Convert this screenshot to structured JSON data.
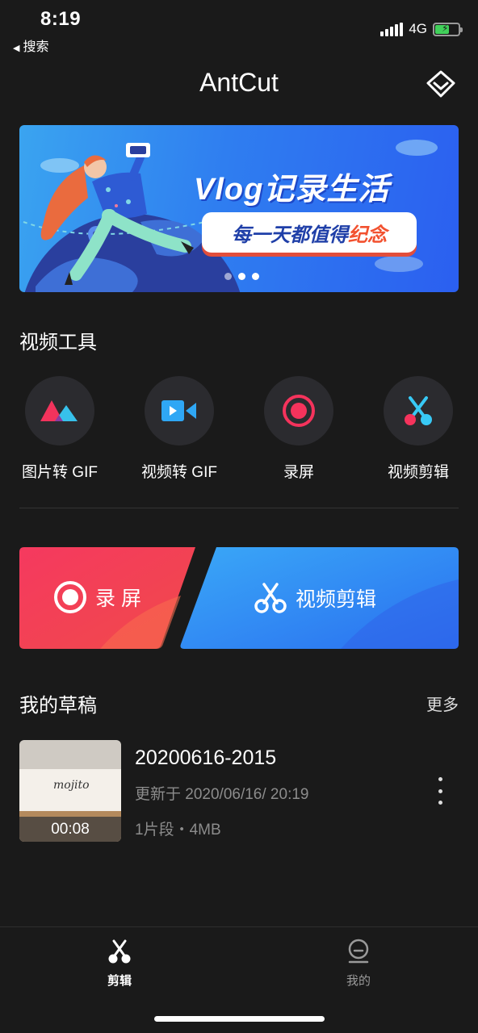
{
  "status_bar": {
    "time": "8:19",
    "back_label": "搜索",
    "network": "4G",
    "battery_color": "#41d05a"
  },
  "header": {
    "title": "AntCut",
    "vip_icon": "diamond-icon"
  },
  "banner": {
    "headline": "Vlog记录生活",
    "tagline_main": "每一天都值得",
    "tagline_accent": "纪念",
    "page_count": 3,
    "active_page": 2,
    "accent_colors": {
      "blue": "#2b5ff0",
      "red": "#f2512f"
    }
  },
  "tools_section": {
    "title": "视频工具",
    "items": [
      {
        "label": "图片转 GIF",
        "icon": "image-to-gif-icon"
      },
      {
        "label": "视频转 GIF",
        "icon": "video-to-gif-icon"
      },
      {
        "label": "录屏",
        "icon": "record-icon"
      },
      {
        "label": "视频剪辑",
        "icon": "scissors-icon"
      }
    ]
  },
  "quick_actions": {
    "record_label": "录 屏",
    "edit_label": "视频剪辑",
    "record_color": "#f5365c",
    "edit_color": "#2f8bf5"
  },
  "drafts_section": {
    "title": "我的草稿",
    "more_label": "更多",
    "items": [
      {
        "name": "20200616-2015",
        "updated": "更新于 2020/06/16/ 20:19",
        "meta": "1片段・4MB",
        "duration": "00:08",
        "thumb_text": "mojito"
      }
    ]
  },
  "tab_bar": {
    "tabs": [
      {
        "label": "剪辑",
        "icon": "scissors-icon",
        "active": true
      },
      {
        "label": "我的",
        "icon": "profile-icon",
        "active": false
      }
    ]
  }
}
